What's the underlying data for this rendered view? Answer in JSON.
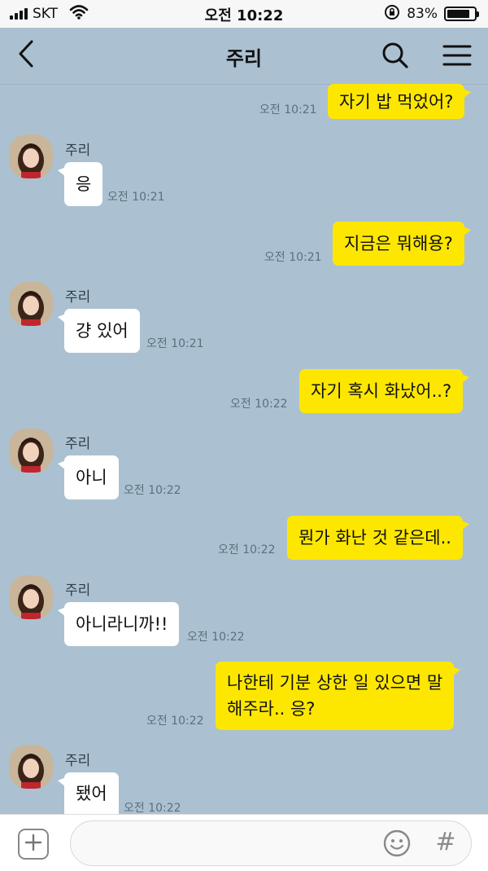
{
  "status_bar": {
    "carrier": "SKT",
    "time": "오전 10:22",
    "battery": "83%",
    "battery_level": 0.83,
    "icons": [
      "signal-icon",
      "wifi-icon",
      "orientation-lock-icon",
      "battery-icon"
    ]
  },
  "header": {
    "title": "주리",
    "icons": [
      "back-arrow-icon",
      "search-icon",
      "hamburger-menu-icon"
    ]
  },
  "messages": [
    {
      "from": "me",
      "text": "자기 밥 먹었어?",
      "time": "오전 10:21"
    },
    {
      "from": "juri",
      "sender": "주리",
      "text": "응",
      "time": "오전 10:21"
    },
    {
      "from": "me",
      "text": "지금은 뭐해용?",
      "time": "오전 10:21"
    },
    {
      "from": "juri",
      "sender": "주리",
      "text": "걍 있어",
      "time": "오전 10:21"
    },
    {
      "from": "me",
      "text": "자기 혹시 화났어..?",
      "time": "오전 10:22"
    },
    {
      "from": "juri",
      "sender": "주리",
      "text": "아니",
      "time": "오전 10:22"
    },
    {
      "from": "me",
      "text": "뭔가 화난 것 같은데..",
      "time": "오전 10:22"
    },
    {
      "from": "juri",
      "sender": "주리",
      "text": "아니라니까!!",
      "time": "오전 10:22"
    },
    {
      "from": "me",
      "text_lines": [
        "나한테 기분 상한 일 있으면 말",
        "해주라.. 응?"
      ],
      "time": "오전 10:22"
    },
    {
      "from": "juri",
      "sender": "주리",
      "text": "됐어",
      "time": "오전 10:22"
    }
  ],
  "input_bar": {
    "placeholder": "",
    "value": "",
    "hash_label": "#",
    "icons": [
      "plus-icon",
      "emoji-icon",
      "hash-icon"
    ]
  },
  "colors": {
    "chat_background": "#abc1d1",
    "my_bubble": "#fde700",
    "their_bubble": "#ffffff"
  }
}
